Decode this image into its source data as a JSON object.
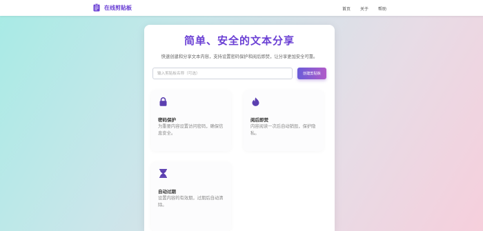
{
  "navbar": {
    "brand": "在线剪贴板",
    "brand_icon": "clipboard-icon",
    "links": [
      "首页",
      "关于",
      "帮助"
    ]
  },
  "hero": {
    "title": "简单、安全的文本分享",
    "subtitle": "快速创建和分享文本内容，支持设置密码保护和阅后即焚，让分享更加安全可靠。"
  },
  "create": {
    "input_value": "",
    "input_placeholder": "输入剪贴板名称（可选）",
    "button_label": "创建剪贴板"
  },
  "features": [
    {
      "icon": "lock-icon",
      "title": "密码保护",
      "desc": "为重要内容设置访问密码，确保信息安全。"
    },
    {
      "icon": "fire-icon",
      "title": "阅后即焚",
      "desc": "内容阅读一次后自动销毁，保护隐私。"
    },
    {
      "icon": "hourglass-icon",
      "title": "自动过期",
      "desc": "设置内容的有效期，过期后自动清除。"
    }
  ],
  "colors": {
    "accent": "#6a3fd4",
    "button_gradient_start": "#6a5cd8",
    "button_gradient_end": "#b05bc8",
    "background_start": "#a7ebe5",
    "background_end": "#f6cfdc"
  }
}
